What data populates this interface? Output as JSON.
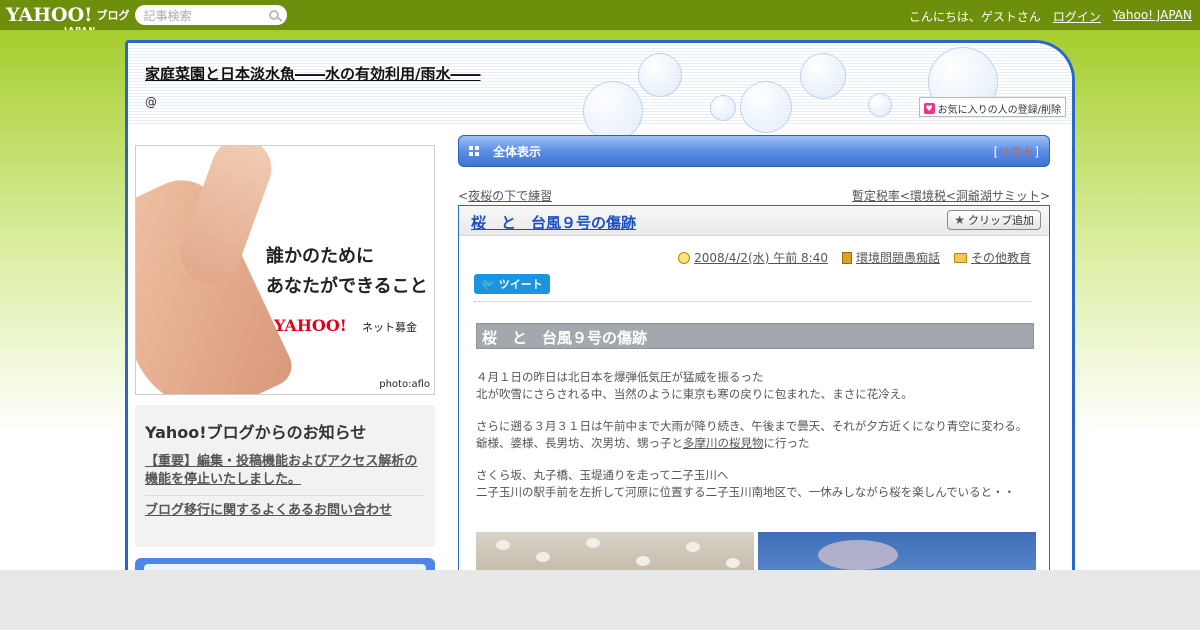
{
  "topbar": {
    "logo": "YAHOO!",
    "logo_sub": "JAPAN",
    "blog_label": "ブログ",
    "search_placeholder": "記事検索",
    "greeting": "こんにちは、ゲストさん",
    "login": "ログイン",
    "yahoo_japan": "Yahoo! JAPAN"
  },
  "header": {
    "title": "家庭菜園と日本淡水魚――水の有効利用/雨水――",
    "subtitle": "@",
    "fav_button": "お気に入りの人の登録/削除"
  },
  "sidebar": {
    "ad": {
      "line1": "誰かのために",
      "line2": "あなたができること",
      "brand": "YAHOO!",
      "brand_sub": "ネット募金",
      "credit": "photo:aflo"
    },
    "notice": {
      "heading": "Yahoo!ブログからのお知らせ",
      "links": [
        "【重要】編集・投稿機能およびアクセス解析の機能を停止いたしました。",
        "ブログ移行に関するよくあるお問い合わせ"
      ]
    }
  },
  "main": {
    "all_label": "全体表示",
    "list_bracket_open": "[",
    "list_label": "リスト",
    "list_bracket_close": "]",
    "prev_prefix": "<",
    "prev_link": "夜桜の下で練習",
    "next_link": "暫定税率<環境税<洞爺湖サミット",
    "next_suffix": ">"
  },
  "article": {
    "title": "桜　と　台風９号の傷跡",
    "clip_button": "クリップ追加",
    "date": "2008/4/2(水) 午前 8:40",
    "category": "環境問題愚痴話",
    "folder": "その他教育",
    "tweet": "ツイート",
    "heading": "桜　と　台風９号の傷跡",
    "p1_l1": "４月１日の昨日は北日本を爆弾低気圧が猛威を振るった",
    "p1_l2": "北が吹雪にさらされる中、当然のように東京も寒の戻りに包まれた、まさに花冷え。",
    "p2_l1": "さらに遡る３月３１日は午前中まで大雨が降り続き、午後まで曇天、それが夕方近くになり青空に変わる。",
    "p2_l2_pre": "爺様、婆様、長男坊、次男坊、甥っ子と",
    "p2_link": "多摩川の桜見物",
    "p2_l2_post": "に行った",
    "p3_l1": "さくら坂、丸子橋、玉堤通りを走って二子玉川へ",
    "p3_l2": "二子玉川の駅手前を左折して河原に位置する二子玉川南地区で、一休みしながら桜を楽しんでいると・・"
  }
}
